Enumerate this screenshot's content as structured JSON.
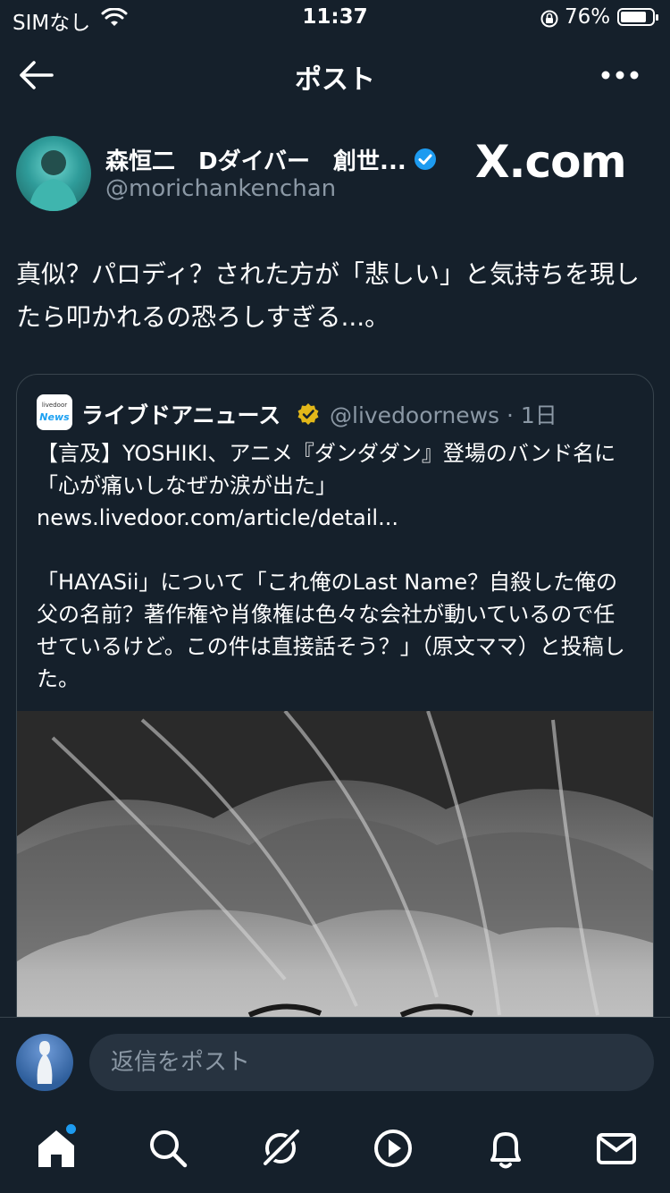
{
  "status_bar": {
    "carrier": "SIMなし",
    "time": "11:37",
    "battery_percent": "76%",
    "battery_level": 0.76,
    "icons": [
      "wifi-icon",
      "orientation-lock-icon",
      "battery-icon"
    ]
  },
  "nav": {
    "title": "ポスト",
    "back_icon": "back-arrow-icon",
    "more_icon": "more-icon"
  },
  "post": {
    "author_name": "森恒二　Dダイバー　創世...",
    "author_handle": "@morichankenchan",
    "verified_icon": "verified-badge-icon",
    "verified_color": "#1d9bf0",
    "watermark": "X.com",
    "text": "真似？パロディ？された方が「悲しい」と気持ちを現したら叩かれるの恐ろしすぎる...。"
  },
  "quote": {
    "logo_small": "livedoor",
    "logo_main": "News",
    "name": "ライブドアニュース",
    "org_badge_color": "#e2b719",
    "meta": "@livedoornews · 1日",
    "line1": "【言及】YOSHIKI、アニメ『ダンダダン』登場のバンド名に「心が痛いしなぜか涙が出た」",
    "link": "news.livedoor.com/article/detail...",
    "paragraph2": "「HAYASii」について「これ俺のLast Name？自殺した俺の父の名前？著作権や肖像権は色々な会社が動いているので任せているけど。この件は直接話そう？」（原文ママ）と投稿した。"
  },
  "reply": {
    "placeholder": "返信をポスト"
  },
  "tabs": [
    {
      "icon": "home-icon",
      "active": true,
      "notification": true
    },
    {
      "icon": "search-icon",
      "active": false
    },
    {
      "icon": "grok-icon",
      "active": false
    },
    {
      "icon": "video-icon",
      "active": false
    },
    {
      "icon": "notifications-icon",
      "active": false
    },
    {
      "icon": "messages-icon",
      "active": false
    }
  ],
  "colors": {
    "background": "#15202b",
    "text": "#ffffff",
    "secondary_text": "#8b98a5",
    "border": "#38444d",
    "accent": "#1d9bf0"
  }
}
